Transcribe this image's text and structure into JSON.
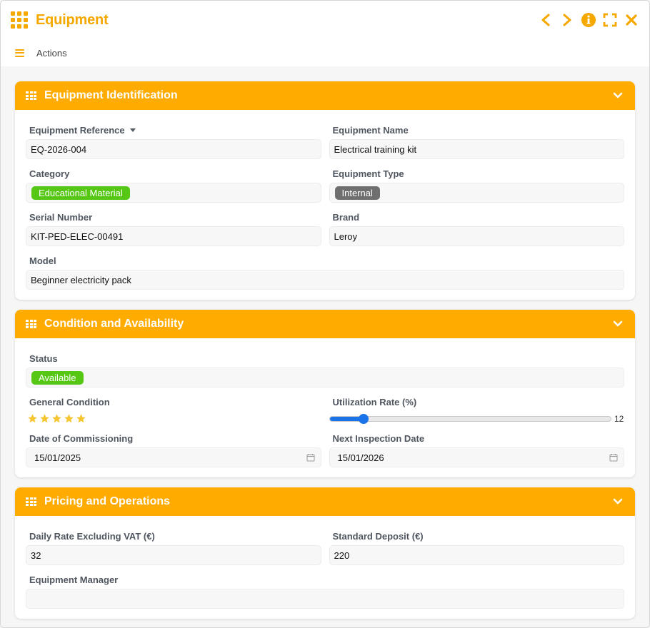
{
  "window": {
    "title": "Equipment",
    "toolbar_label": "Actions",
    "accent_color": "#f5a800"
  },
  "sections": {
    "identification": {
      "title": "Equipment Identification",
      "reference_label": "Equipment Reference",
      "reference_value": "EQ-2026-004",
      "name_label": "Equipment Name",
      "name_value": "Electrical training kit",
      "category_label": "Category",
      "category_value": "Educational Material",
      "type_label": "Equipment Type",
      "type_value": "Internal",
      "serial_label": "Serial Number",
      "serial_value": "KIT-PED-ELEC-00491",
      "brand_label": "Brand",
      "brand_value": "Leroy",
      "model_label": "Model",
      "model_value": "Beginner electricity pack"
    },
    "condition": {
      "title": "Condition and Availability",
      "status_label": "Status",
      "status_value": "Available",
      "general_condition_label": "General Condition",
      "general_condition_stars": 5,
      "utilization_label": "Utilization Rate (%)",
      "utilization_value": "12",
      "commissioning_label": "Date of Commissioning",
      "commissioning_value": "15/01/2025",
      "next_inspection_label": "Next Inspection Date",
      "next_inspection_value": "15/01/2026"
    },
    "pricing": {
      "title": "Pricing and Operations",
      "daily_rate_label": "Daily Rate Excluding VAT (€)",
      "daily_rate_value": "32",
      "deposit_label": "Standard Deposit (€)",
      "deposit_value": "220",
      "manager_label": "Equipment Manager",
      "manager_value": ""
    }
  }
}
